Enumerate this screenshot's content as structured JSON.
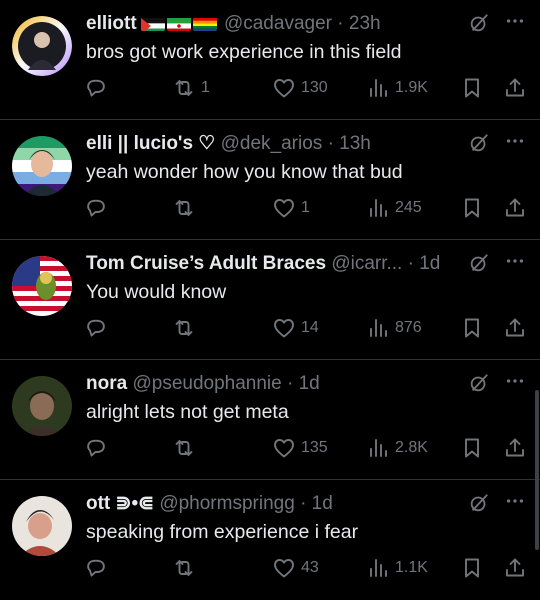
{
  "replies": [
    {
      "name": "elliott",
      "flags": [
        "palestine",
        "iran",
        "pride"
      ],
      "handle": "@cadavager",
      "time": "23h",
      "text": "bros got work experience in this field",
      "reposts": "1",
      "likes": "130",
      "views": "1.9K"
    },
    {
      "name": "elli || lucio's ♡",
      "handle": "@dek_arios",
      "time": "13h",
      "text": "yeah wonder how you know that bud",
      "reposts": "",
      "likes": "1",
      "views": "245"
    },
    {
      "name": "Tom Cruise’s Adult Braces",
      "handle": "@icarr...",
      "time": "1d",
      "text": "You would know",
      "reposts": "",
      "likes": "14",
      "views": "876"
    },
    {
      "name": "nora",
      "handle": "@pseudophannie",
      "time": "1d",
      "text": "alright lets not get meta",
      "reposts": "",
      "likes": "135",
      "views": "2.8K"
    },
    {
      "name": "ott ⋑•⋐",
      "handle": "@phormspringg",
      "time": "1d",
      "text": "speaking from experience i fear",
      "reposts": "",
      "likes": "43",
      "views": "1.1K"
    }
  ],
  "separator": "·",
  "icons": {
    "reply": "reply-icon",
    "repost": "repost-icon",
    "like": "heart-icon",
    "views": "views-icon",
    "bookmark": "bookmark-icon",
    "share": "share-icon",
    "grok": "grok-icon",
    "more": "more-icon"
  },
  "colors": {
    "background": "#000000",
    "text": "#e7e9ea",
    "muted": "#71767b",
    "divider": "#2f3336"
  }
}
